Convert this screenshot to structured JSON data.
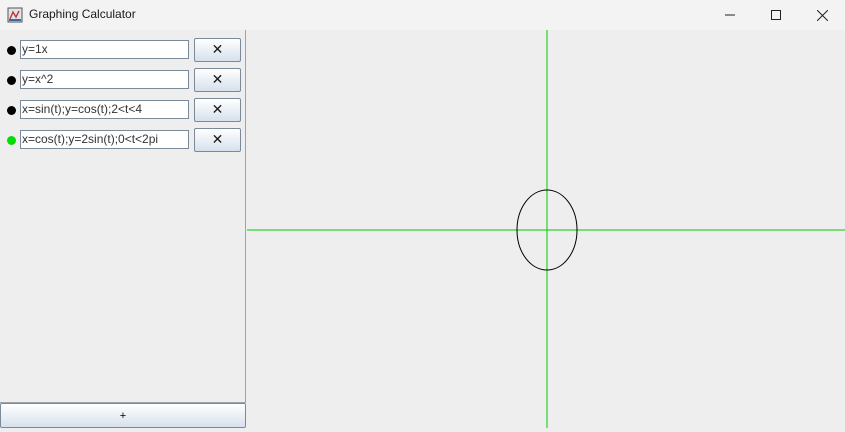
{
  "window": {
    "title": "Graphing Calculator"
  },
  "equations": [
    {
      "text": "y=1x",
      "color": "#000000",
      "delete_label": "✕"
    },
    {
      "text": "y=x^2",
      "color": "#000000",
      "delete_label": "✕"
    },
    {
      "text": "x=sin(t);y=cos(t);2<t<4",
      "color": "#000000",
      "delete_label": "✕"
    },
    {
      "text": "x=cos(t);y=2sin(t);0<t<2pi",
      "color": "#00dd00",
      "delete_label": "✕"
    }
  ],
  "add_button": {
    "label": "+"
  },
  "graph": {
    "axis_color": "#00cc00",
    "curve_color": "#000000"
  }
}
